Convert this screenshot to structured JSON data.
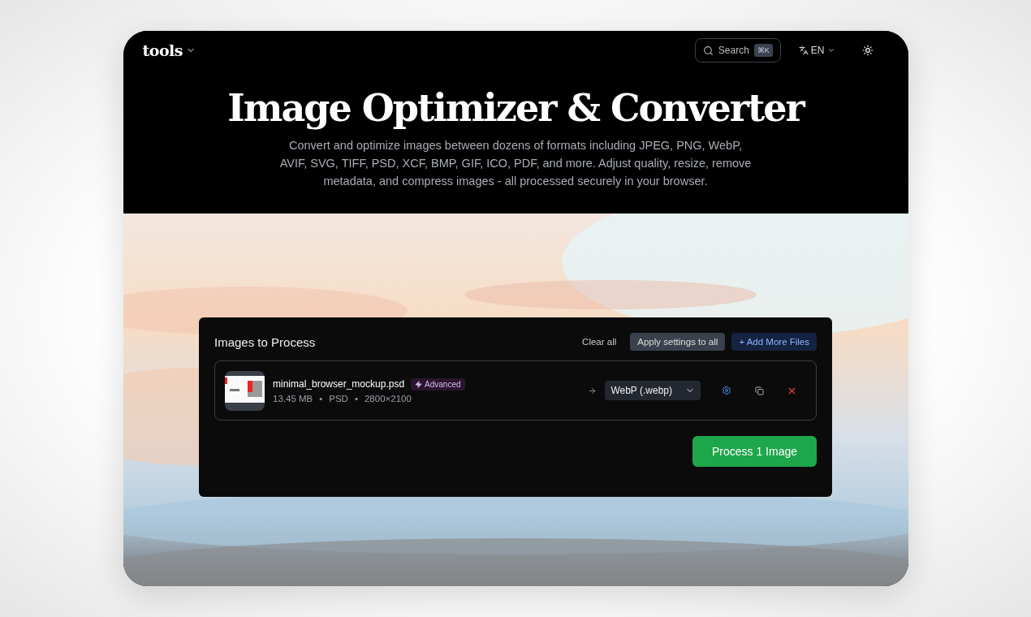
{
  "nav": {
    "logo": "tools",
    "search": {
      "label": "Search",
      "shortcut": "⌘K"
    },
    "language": "EN"
  },
  "hero": {
    "title": "Image Optimizer & Converter",
    "description": "Convert and optimize images between dozens of formats including JPEG, PNG, WebP, AVIF, SVG, TIFF, PSD, XCF, BMP, GIF, ICO, PDF, and more. Adjust quality, resize, remove metadata, and compress images - all processed securely in your browser."
  },
  "panel": {
    "title": "Images to Process",
    "actions": [
      {
        "label": "Clear all",
        "kind": "plain"
      },
      {
        "label": "Apply settings to all",
        "kind": "secondary"
      },
      {
        "label": "+ Add More Files",
        "kind": "accent"
      }
    ],
    "files": [
      {
        "name": "minimal_browser_mockup.psd",
        "badge": "Advanced",
        "details": [
          "13.45 MB",
          "•",
          "PSD",
          "•",
          "2800×2100"
        ],
        "target": "WebP (.webp)"
      }
    ],
    "submit": "Process 1 Image"
  }
}
